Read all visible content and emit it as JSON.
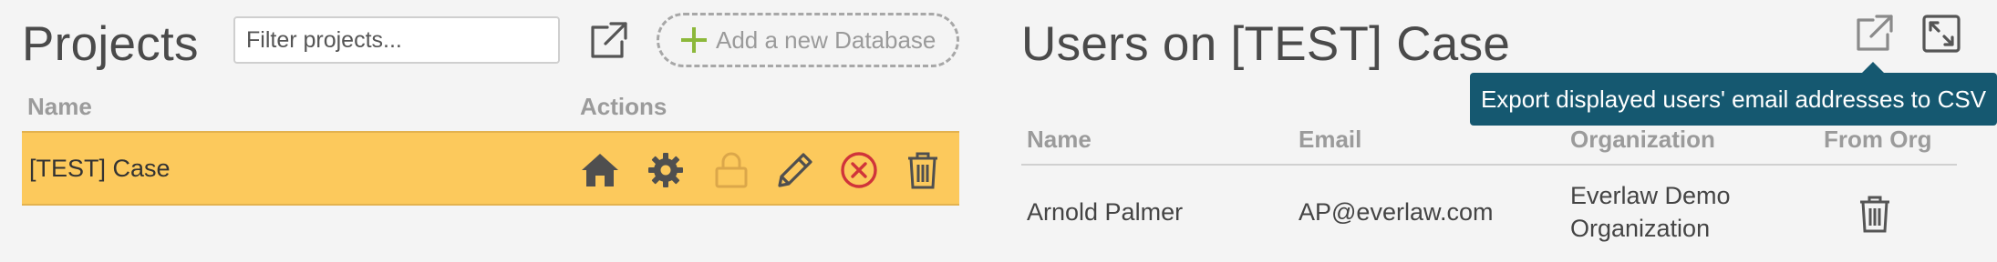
{
  "projects": {
    "title": "Projects",
    "filter_placeholder": "Filter projects...",
    "export_icon": "external-link-icon",
    "add_db_label": "Add a new Database",
    "columns": {
      "name": "Name",
      "actions": "Actions"
    },
    "rows": [
      {
        "name": "[TEST] Case",
        "actions": [
          "home-icon",
          "gear-icon",
          "lock-icon",
          "pencil-icon",
          "remove-circle-icon",
          "trash-icon"
        ]
      }
    ]
  },
  "users": {
    "title": "Users on [TEST] Case",
    "columns": {
      "name": "Name",
      "email": "Email",
      "organization": "Organization",
      "from_org": "From Org"
    },
    "rows": [
      {
        "name": "Arnold Palmer",
        "email": "AP@everlaw.com",
        "organization_line1": "Everlaw Demo",
        "organization_line2": "Organization"
      }
    ],
    "tooltip": "Export displayed users' email addresses to CSV"
  },
  "colors": {
    "selected_row": "#fcc95c",
    "tooltip_bg": "#155870",
    "add_plus": "#8cb83a",
    "remove_red": "#d0343a",
    "icon_dark": "#4f4f4f"
  }
}
